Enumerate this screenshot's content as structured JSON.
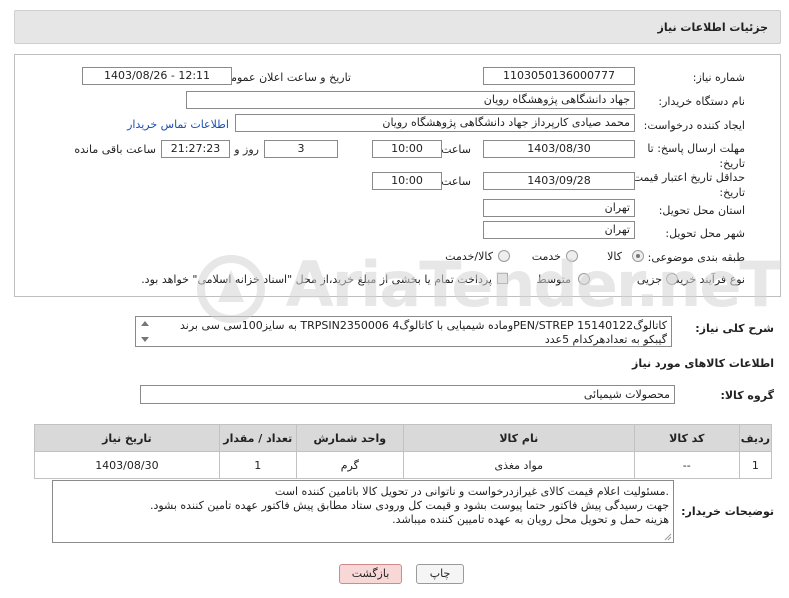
{
  "header": {
    "title": "جزئیات اطلاعات نیاز"
  },
  "form": {
    "need_number_label": "شماره نیاز:",
    "need_number": "1103050136000777",
    "announce_label": "تاریخ و ساعت اعلان عمومی:",
    "announce_value": "1403/08/26 - 12:11",
    "buyer_org_label": "نام دستگاه خریدار:",
    "buyer_org": "جهاد دانشگاهی پژوهشگاه رویان",
    "creator_label": "ایجاد کننده درخواست:",
    "creator": "محمد صیادی کارپرداز جهاد دانشگاهی پژوهشگاه رویان",
    "contact_link": "اطلاعات تماس خریدار",
    "deadline_label": "مهلت ارسال پاسخ: تا تاریخ:",
    "deadline_date": "1403/08/30",
    "time_label": "ساعت",
    "deadline_time": "10:00",
    "days_value": "3",
    "days_label": "روز و",
    "remaining_time": "21:27:23",
    "remaining_label": "ساعت باقی مانده",
    "validity_label": "حداقل تاریخ اعتبار قیمت: تا تاریخ:",
    "validity_date": "1403/09/28",
    "validity_time": "10:00",
    "province_label": "استان محل تحویل:",
    "province": "تهران",
    "city_label": "شهر محل تحویل:",
    "city": "تهران",
    "category_label": "طبقه بندی موضوعی:",
    "category_options": [
      "کالا",
      "خدمت",
      "کالا/خدمت"
    ],
    "category_selected": "کالا",
    "process_label": "نوع فرآیند خرید :",
    "process_options": [
      "جزیی",
      "متوسط"
    ],
    "payment_note": "پرداخت تمام یا بخشی از مبلغ خرید،از محل \"اسناد خزانه اسلامی\" خواهد بود."
  },
  "summary": {
    "label": "شرح کلی نیاز:",
    "line1": "کاتالوگPEN/STREP 15140122وماده شیمیایی با کاتالوگ4 TRPSIN2350006 به سایز100سی سی برند",
    "line2": "گیبکو به تعدادهرکدام 5عدد"
  },
  "goods": {
    "section_title": "اطلاعات کالاهای مورد نیاز",
    "group_label": "گروه کالا:",
    "group_value": "محصولات شیمیائی",
    "columns": [
      "ردیف",
      "کد کالا",
      "نام کالا",
      "واحد شمارش",
      "تعداد / مقدار",
      "تاریخ نیاز"
    ],
    "rows": [
      {
        "row": "1",
        "code": "--",
        "name": "مواد مغذی",
        "unit": "گرم",
        "qty": "1",
        "date": "1403/08/30"
      }
    ]
  },
  "notes": {
    "label": "توضیحات خریدار:",
    "line1": ".مسئولیت اعلام قیمت کالای غیرازدرخواست و ناتوانی در تحویل کالا باتامین کننده است",
    "line2": "جهت رسیدگی پیش فاکتور حتما پیوست بشود و قیمت کل ورودی ستاد مطابق پیش فاکتور عهده تامین کننده بشود.",
    "line3": "هزینه حمل و تحویل محل رویان به عهده تامیین کننده میباشد."
  },
  "buttons": {
    "print": "چاپ",
    "back": "بازگشت"
  },
  "watermark": {
    "text": "AriaTender.neT"
  },
  "colors": {
    "link": "#1a4fb3",
    "back_button_bg": "#f8d7d7",
    "back_button_border": "#d08a8a",
    "header_bg": "#e6e6e6"
  }
}
